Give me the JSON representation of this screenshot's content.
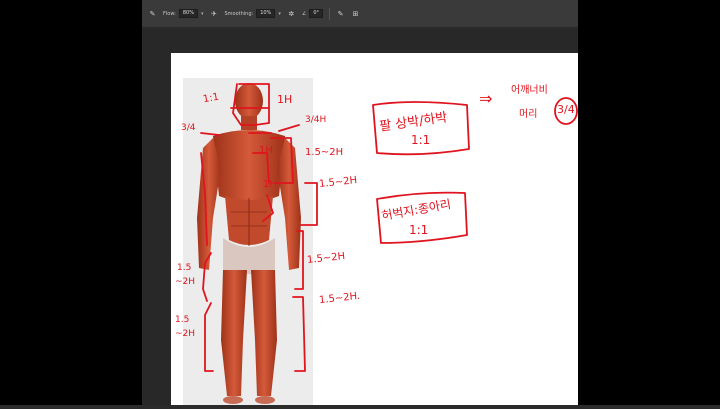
{
  "toolbar": {
    "flow_label": "Flow:",
    "flow_value": "80%",
    "smoothing_label": "Smoothing:",
    "smoothing_value": "10%",
    "angle_value": "0°"
  },
  "icons": {
    "brush_options": "pencil-icon",
    "smoothing_settings": "gear-icon",
    "angle": "angle-icon",
    "pressure_size": "pressure-icon",
    "symmetry": "symmetry-icon"
  },
  "annotations": {
    "ratio_head": "1:1",
    "head_unit": "1H",
    "shoulder_fraction": "3/4H",
    "left_fraction": "3/4",
    "torso_unit": "1H",
    "range_chest": "1.5~2H",
    "waist_unit": "1H",
    "range_pelvis": "1.5~2H",
    "range_thigh": "1.5~2H",
    "range_calf": "1.5~2H.",
    "left_thigh_top": "1.5",
    "left_thigh_bottom": "~2H",
    "left_calf_top": "1.5",
    "left_calf_bottom": "~2H",
    "arm_note_line1": "팔 상박/하박",
    "arm_note_line2": "1:1",
    "arrow": "⇒",
    "shoulder_note_line1": "어깨너비",
    "shoulder_note_line2": "머리",
    "shoulder_note_circle": "3/4",
    "leg_note_line1": "허벅지:종아리",
    "leg_note_line2": "1:1"
  },
  "colors": {
    "ink": "#e0141e",
    "muscle": "#c8452a",
    "workspace": "#282828",
    "toolbar": "#3a3a3a"
  }
}
